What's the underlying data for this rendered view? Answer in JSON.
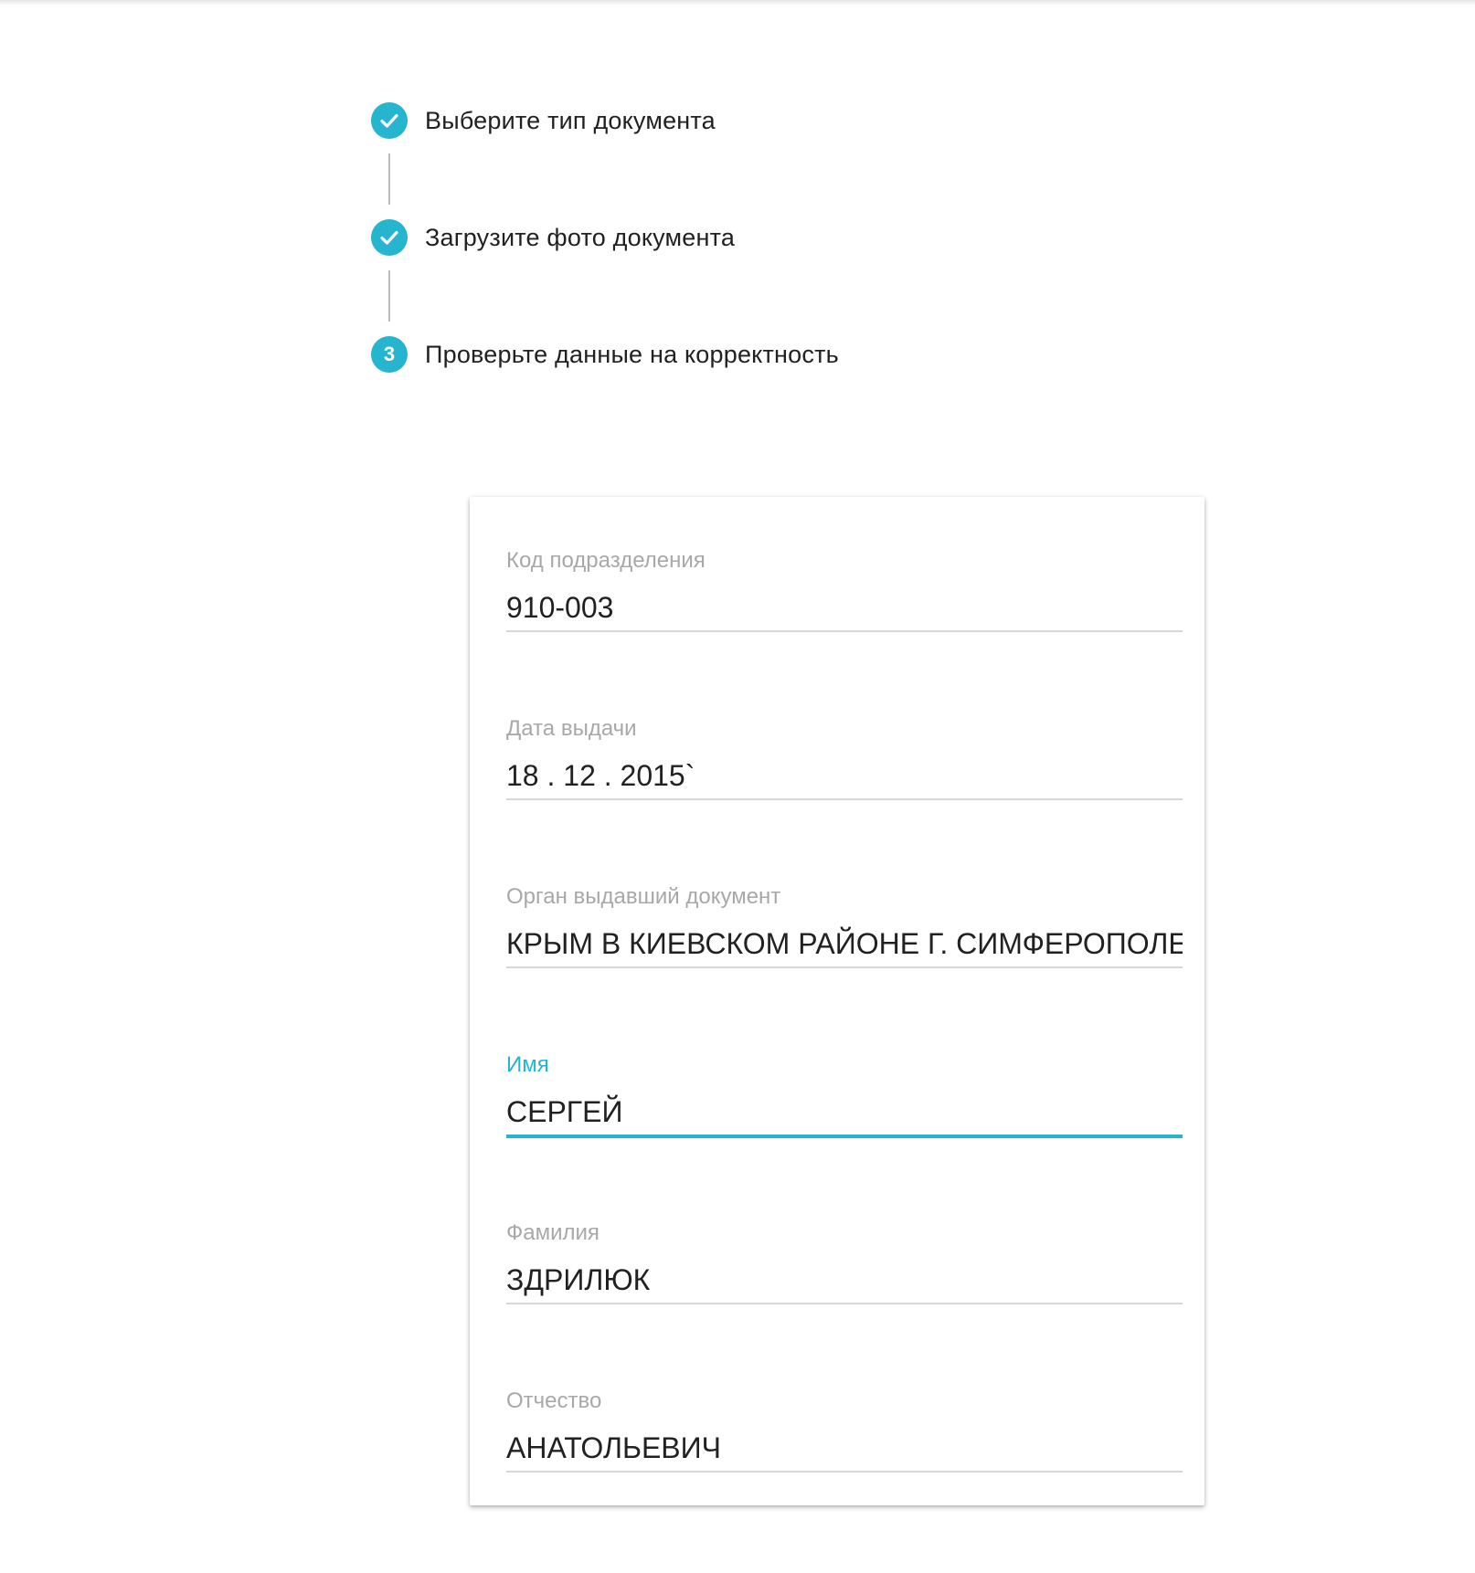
{
  "stepper": {
    "steps": [
      {
        "label": "Выберите тип документа",
        "status": "completed",
        "icon": "check-icon"
      },
      {
        "label": "Загрузите фото документа",
        "status": "completed",
        "icon": "check-icon"
      },
      {
        "label": "Проверьте данные на корректность",
        "status": "active",
        "number": "3"
      }
    ],
    "accent_color": "#26b5cf"
  },
  "form": {
    "fields": [
      {
        "label": "Код подразделения",
        "value": "910-003",
        "focused": false
      },
      {
        "label": "Дата выдачи",
        "value": "18 . 12 . 2015`",
        "focused": false
      },
      {
        "label": "Орган выдавший документ",
        "value": "КРЫМ В КИЕВСКОМ РАЙОНЕ Г. СИМФЕРОПОЛЕ",
        "focused": false
      },
      {
        "label": "Имя",
        "value": "СЕРГЕЙ",
        "focused": true
      },
      {
        "label": "Фамилия",
        "value": "ЗДРИЛЮК",
        "focused": false
      },
      {
        "label": "Отчество",
        "value": "АНАТОЛЬЕВИЧ",
        "focused": false
      }
    ]
  }
}
